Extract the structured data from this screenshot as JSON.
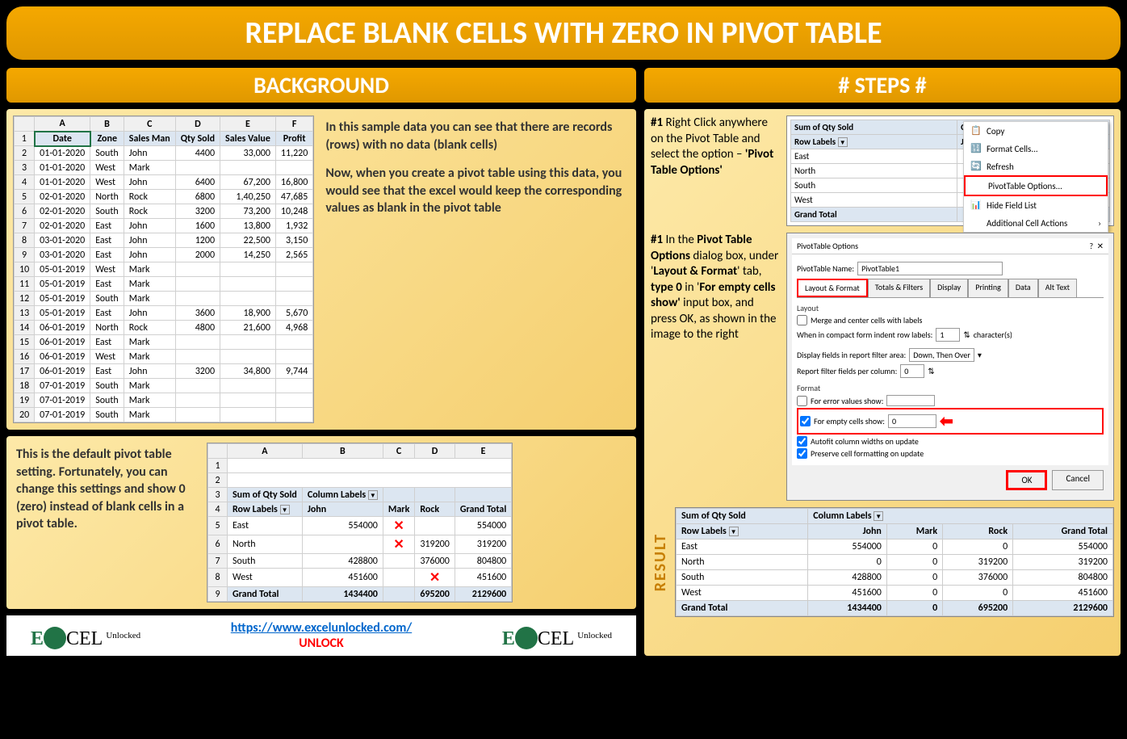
{
  "title": "REPLACE BLANK CELLS WITH ZERO IN PIVOT TABLE",
  "sections": {
    "background": "BACKGROUND",
    "steps": "# STEPS #"
  },
  "source_columns": [
    "",
    "A",
    "B",
    "C",
    "D",
    "E",
    "F"
  ],
  "source_headers": [
    "Date",
    "Zone",
    "Sales Man",
    "Qty Sold",
    "Sales Value",
    "Profit"
  ],
  "source_data": [
    [
      "01-01-2020",
      "South",
      "John",
      "4400",
      "33,000",
      "11,220"
    ],
    [
      "01-01-2020",
      "West",
      "Mark",
      "",
      "",
      ""
    ],
    [
      "01-01-2020",
      "West",
      "John",
      "6400",
      "67,200",
      "16,800"
    ],
    [
      "02-01-2020",
      "North",
      "Rock",
      "6800",
      "1,40,250",
      "47,685"
    ],
    [
      "02-01-2020",
      "South",
      "Rock",
      "3200",
      "73,200",
      "10,248"
    ],
    [
      "02-01-2020",
      "East",
      "John",
      "1600",
      "13,800",
      "1,932"
    ],
    [
      "03-01-2020",
      "East",
      "John",
      "1200",
      "22,500",
      "3,150"
    ],
    [
      "03-01-2020",
      "East",
      "John",
      "2000",
      "14,250",
      "2,565"
    ],
    [
      "05-01-2019",
      "West",
      "Mark",
      "",
      "",
      ""
    ],
    [
      "05-01-2019",
      "East",
      "Mark",
      "",
      "",
      ""
    ],
    [
      "05-01-2019",
      "South",
      "Mark",
      "",
      "",
      ""
    ],
    [
      "05-01-2019",
      "East",
      "John",
      "3600",
      "18,900",
      "5,670"
    ],
    [
      "06-01-2019",
      "North",
      "Rock",
      "4800",
      "21,600",
      "4,968"
    ],
    [
      "06-01-2019",
      "East",
      "Mark",
      "",
      "",
      ""
    ],
    [
      "06-01-2019",
      "West",
      "Mark",
      "",
      "",
      ""
    ],
    [
      "06-01-2019",
      "East",
      "John",
      "3200",
      "34,800",
      "9,744"
    ],
    [
      "07-01-2019",
      "South",
      "Mark",
      "",
      "",
      ""
    ],
    [
      "07-01-2019",
      "South",
      "Mark",
      "",
      "",
      ""
    ],
    [
      "07-01-2019",
      "South",
      "Mark",
      "",
      "",
      ""
    ]
  ],
  "bg_text1": "In this sample data you can see that there are records (rows) with no data (blank cells)",
  "bg_text2": "Now, when you create a pivot table using this data, you would see that the excel would keep the corresponding values as blank in the pivot table",
  "bg_text3": "This is the default pivot table setting. Fortunately, you can change this settings and show 0 (zero) instead of blank cells in a pivot table.",
  "pivot_default": {
    "cols": [
      "",
      "A",
      "B",
      "C",
      "D",
      "E"
    ],
    "corner": "Sum of Qty Sold",
    "col_label": "Column Labels",
    "row_label": "Row Labels",
    "headers": [
      "John",
      "Mark",
      "Rock",
      "Grand Total"
    ],
    "rows": [
      [
        "East",
        "554000",
        "X",
        "",
        "554000"
      ],
      [
        "North",
        "",
        "X",
        "319200",
        "319200"
      ],
      [
        "South",
        "428800",
        "",
        "376000",
        "804800"
      ],
      [
        "West",
        "451600",
        "",
        "X",
        "451600"
      ],
      [
        "Grand Total",
        "1434400",
        "",
        "695200",
        "2129600"
      ]
    ]
  },
  "step1_text": {
    "num": "#1",
    "body": " Right Click anywhere on the Pivot Table and select the option – ",
    "bold": "'Pivot Table Options'"
  },
  "step2_text": {
    "num": "#1",
    "p1": " In the ",
    "b1": "Pivot Table Options",
    "p2": " dialog box, under '",
    "b2": "Layout & Format",
    "p3": "' tab, ",
    "b3": "type 0",
    "p4": " in '",
    "b4": "For empty cells show'",
    "p5": " input box, and press OK, as shown in the image to the right"
  },
  "ctx_pivot": {
    "corner": "Sum of Qty Sold",
    "col_label": "Column Labels",
    "row_label": "Row Labels",
    "col1": "John",
    "rows": [
      "East",
      "North",
      "South",
      "West",
      "Grand Total"
    ]
  },
  "ctx_menu": [
    "Copy",
    "Format Cells...",
    "Refresh",
    "PivotTable Options...",
    "Hide Field List",
    "Additional Cell Actions"
  ],
  "dialog": {
    "title": "PivotTable Options",
    "name_label": "PivotTable Name:",
    "name_value": "PivotTable1",
    "tabs": [
      "Layout & Format",
      "Totals & Filters",
      "Display",
      "Printing",
      "Data",
      "Alt Text"
    ],
    "layout_label": "Layout",
    "merge": "Merge and center cells with labels",
    "indent_label": "When in compact form indent row labels:",
    "indent_value": "1",
    "indent_suffix": "character(s)",
    "display_label": "Display fields in report filter area:",
    "display_value": "Down, Then Over",
    "report_label": "Report filter fields per column:",
    "report_value": "0",
    "format_label": "Format",
    "error_label": "For error values show:",
    "empty_label": "For empty cells show:",
    "empty_value": "0",
    "autofit": "Autofit column widths on update",
    "preserve": "Preserve cell formatting on update",
    "ok": "OK",
    "cancel": "Cancel"
  },
  "result_label": "RESULT",
  "result": {
    "corner": "Sum of Qty Sold",
    "col_label": "Column Labels",
    "row_label": "Row Labels",
    "headers": [
      "John",
      "Mark",
      "Rock",
      "Grand Total"
    ],
    "rows": [
      [
        "East",
        "554000",
        "0",
        "0",
        "554000"
      ],
      [
        "North",
        "0",
        "0",
        "319200",
        "319200"
      ],
      [
        "South",
        "428800",
        "0",
        "376000",
        "804800"
      ],
      [
        "West",
        "451600",
        "0",
        "0",
        "451600"
      ],
      [
        "Grand Total",
        "1434400",
        "0",
        "695200",
        "2129600"
      ]
    ]
  },
  "footer": {
    "logo1": "E",
    "logo2": "CEL",
    "logo3": "Unlocked",
    "link": "https://www.excelunlocked.com/",
    "unlock": "UNLOCK"
  }
}
